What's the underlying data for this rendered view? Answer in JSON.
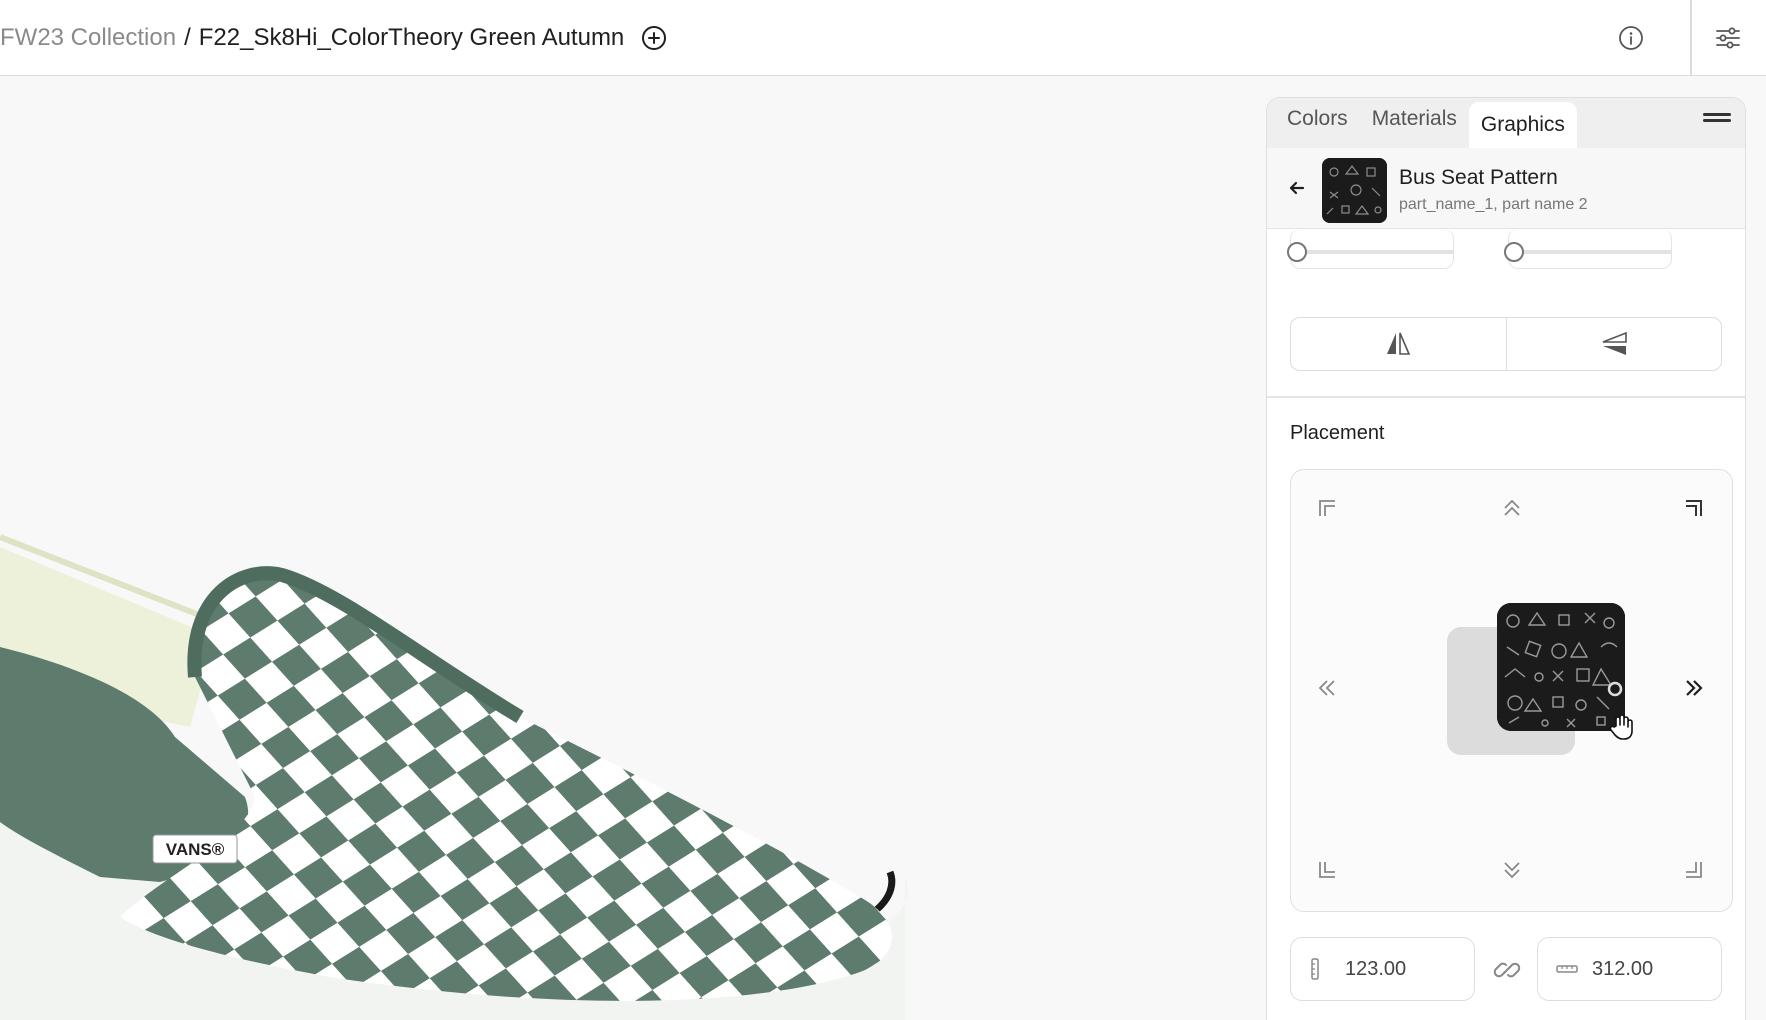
{
  "breadcrumb": {
    "parent": "FW23 Collection",
    "separator": "/",
    "current": "F22_Sk8Hi_ColorTheory Green Autumn"
  },
  "panel": {
    "tabs": [
      {
        "label": "Colors",
        "active": false
      },
      {
        "label": "Materials",
        "active": false
      },
      {
        "label": "Graphics",
        "active": true
      }
    ],
    "graphic": {
      "title": "Bus Seat Pattern",
      "subtitle": "part_name_1, part name 2"
    },
    "placement": {
      "section_title": "Placement"
    },
    "dimensions": {
      "height_value": "123.00",
      "width_value": "312.00"
    }
  },
  "shoe_logo_text": "VANS®",
  "colors": {
    "shoe_green": "#5d7c6d",
    "accent_text": "#1f1f1f",
    "muted_text": "#8a8a8a"
  }
}
